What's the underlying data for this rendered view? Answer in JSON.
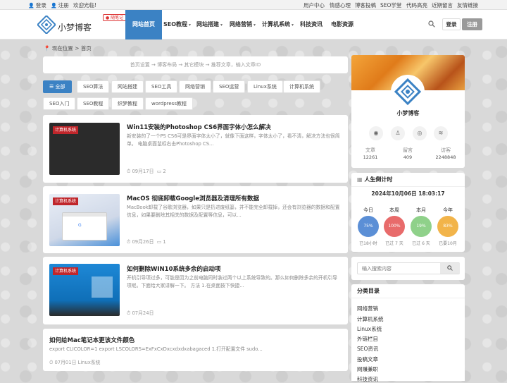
{
  "topbar": {
    "login": "登录",
    "register": "注册",
    "welcome": "欢迎光临!",
    "links": [
      "用户中心",
      "情感心理",
      "博客投稿",
      "SEO学堂",
      "代码高亮",
      "近期留言",
      "友情链接"
    ]
  },
  "header": {
    "logo_text": "小梦博客",
    "live_badge": "随笔记",
    "nav": [
      {
        "label": "网站首页",
        "active": true,
        "dropdown": false
      },
      {
        "label": "SEO教程",
        "active": false,
        "dropdown": true
      },
      {
        "label": "网站搭建",
        "active": false,
        "dropdown": true
      },
      {
        "label": "网络营销",
        "active": false,
        "dropdown": true
      },
      {
        "label": "计算机系统",
        "active": false,
        "dropdown": true
      },
      {
        "label": "科技资讯",
        "active": false,
        "dropdown": false
      },
      {
        "label": "电影资源",
        "active": false,
        "dropdown": false
      }
    ],
    "login_button": "登录",
    "register_button": "注册"
  },
  "breadcrumb": {
    "label": "现在位置",
    "sep": ">",
    "current": "首页"
  },
  "subnav": [
    "首页设置",
    "博客布局",
    "其它模块",
    "推荐文章，输入文章ID"
  ],
  "tags": [
    "全部",
    "SEO算法",
    "网站搭建",
    "SEO工具",
    "网络营销",
    "SEO运营",
    "Linux系统",
    "计算机系统",
    "SEO入门",
    "SEO教程",
    "织梦教程",
    "wordpress教程"
  ],
  "posts": [
    {
      "badge": "计算机系统",
      "title": "Win11安装的Photoshop CS6界面字体小怎么解决",
      "excerpt": "新安装的了一个PS CS6可是界面字体太小了，就像下面这样，字体太小了，看不清，解决方法也很简单。 电脑桌面鼠标右击Photoshop CS...",
      "date": "09月17日",
      "comments": "2"
    },
    {
      "badge": "计算机系统",
      "title": "MacOS 彻底卸载Google浏览器及清理所有数据",
      "excerpt": "MacBook卸载了谷歌浏览器，如果只是扔进废纸篓，并不能完全卸载掉，还会有浏览器的数据和配置信息，如果要删除其相关的数据及配置等信息，可以...",
      "date": "09月26日",
      "comments": "1"
    },
    {
      "badge": "计算机系统",
      "title": "如何删除WIN10系统多余的启动项",
      "excerpt": "开机引导项过多，可能是因为之前电脑同时装过两个以上系统导致的。那么如何删除多余的开机引导项呢。下面给大家讲解一下。 方法 1.在桌面按下快捷...",
      "date": "07月24日",
      "comments": ""
    },
    {
      "badge": "",
      "title": "如何给Mac笔记本更该文件颜色",
      "excerpt": "export CLICOLOR=1 export LSCOLORS=ExFxCxDxcxdxdxabagaced 1.打开配置文件 sudo...",
      "date": "07月01日",
      "comments": "Linux系统"
    }
  ],
  "profile": {
    "name": "小梦博客",
    "stats": [
      {
        "label": "文章",
        "value": "12261"
      },
      {
        "label": "留言",
        "value": "409"
      },
      {
        "label": "访客",
        "value": "2248848"
      }
    ]
  },
  "countdown": {
    "title": "人生倒计时",
    "datetime": "2024年10月06日 18:03:17",
    "items": [
      {
        "label": "今日",
        "percent": "75%",
        "sub": "已18小时",
        "color": "#5b8fd6"
      },
      {
        "label": "本周",
        "percent": "100%",
        "sub": "已过 7 天",
        "color": "#e86b6b"
      },
      {
        "label": "本月",
        "percent": "19%",
        "sub": "已过 6 天",
        "color": "#8fd18a"
      },
      {
        "label": "今年",
        "percent": "83%",
        "sub": "已要10月",
        "color": "#f2b44a"
      }
    ]
  },
  "search": {
    "placeholder": "输入搜索内容"
  },
  "categories": {
    "title": "分类目录",
    "items": [
      "网络营销",
      "计算机系统",
      "Linux系统",
      "外链栏目",
      "SEO资讯",
      "投稿文章",
      "网赚兼职",
      "科技资讯"
    ]
  },
  "colors": {
    "accent": "#3b82c4",
    "badge": "#c0262b"
  }
}
